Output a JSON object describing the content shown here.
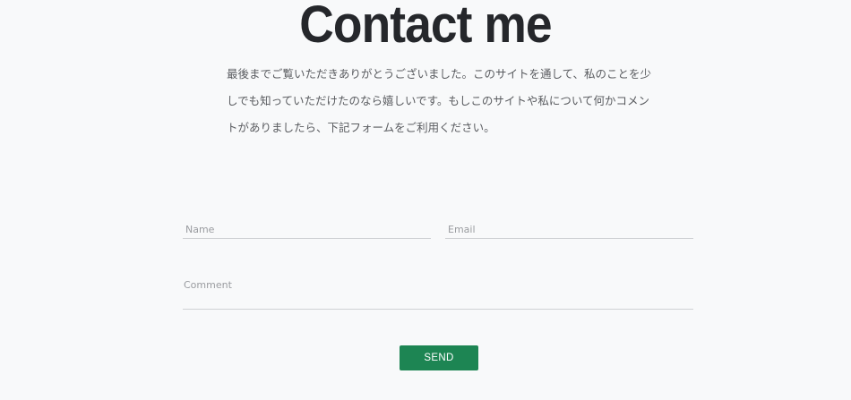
{
  "header": {
    "title": "Contact me"
  },
  "intro": {
    "text": "最後までご覧いただきありがとうございました。このサイトを通して、私のことを少しでも知っていただけたのなら嬉しいです。もしこのサイトや私について何かコメントがありましたら、下記フォームをご利用ください。"
  },
  "form": {
    "name_placeholder": "Name",
    "email_placeholder": "Email",
    "comment_placeholder": "Comment",
    "send_label": "SEND"
  },
  "colors": {
    "background": "#f8f9fa",
    "title": "#25272b",
    "button": "#1d8553"
  }
}
